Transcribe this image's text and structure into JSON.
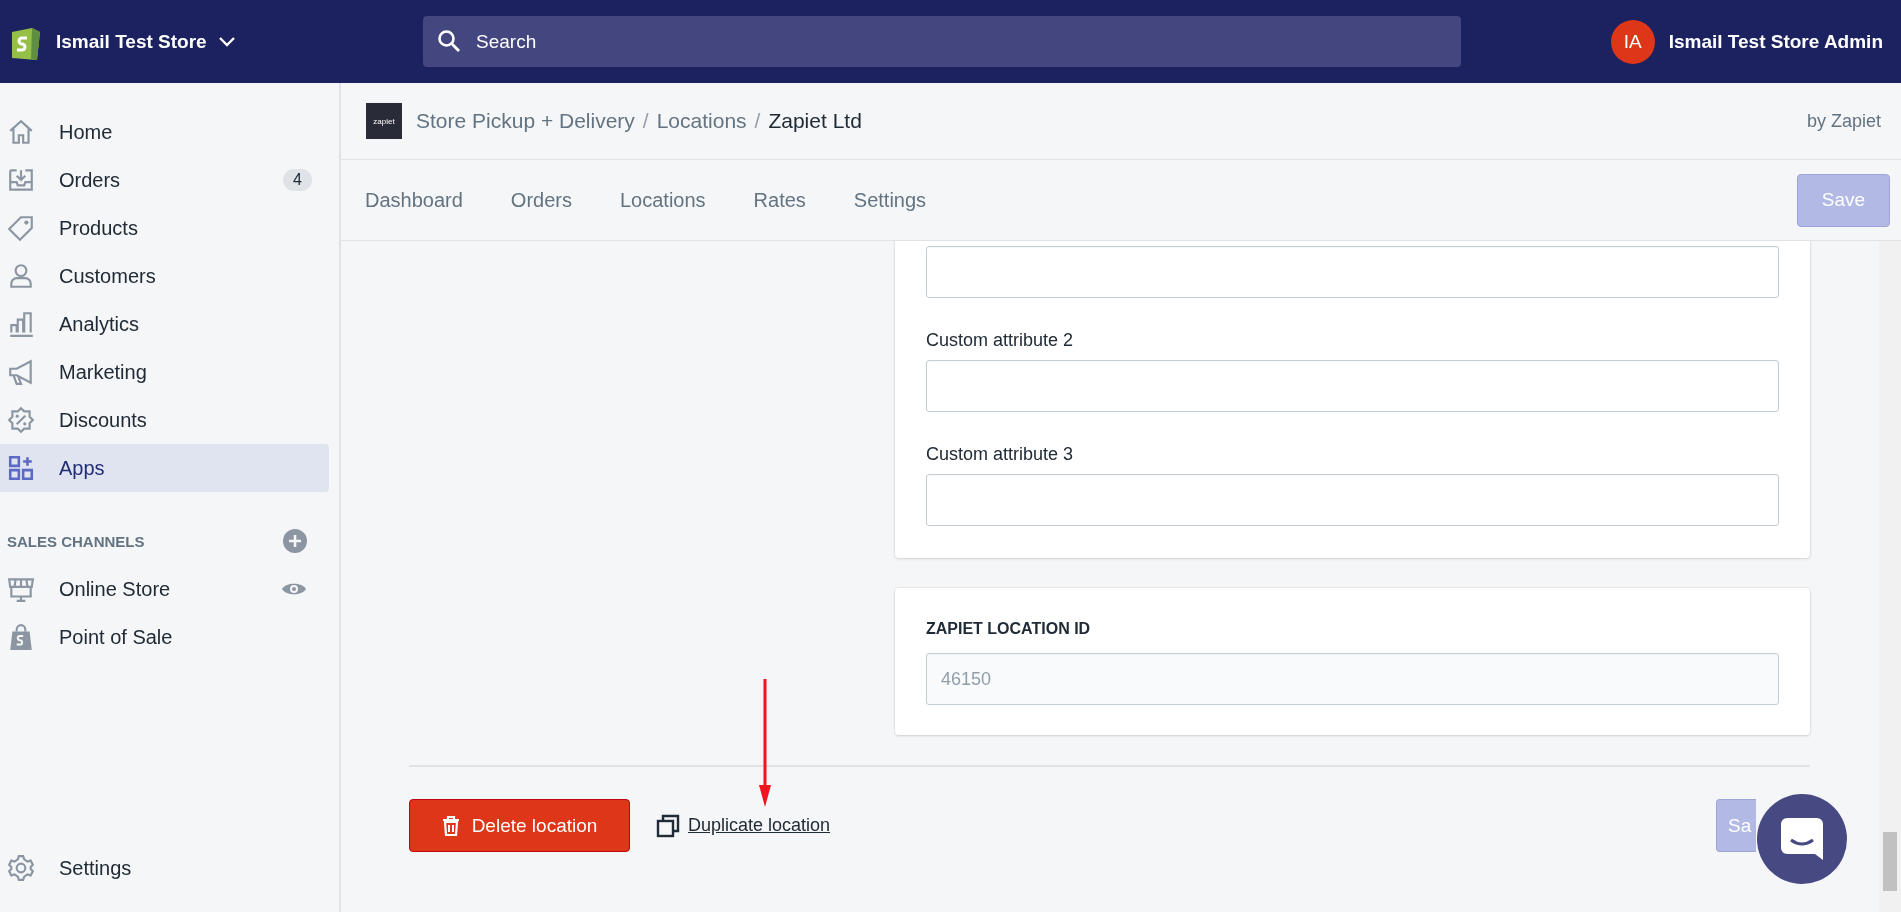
{
  "top_bar": {
    "store_name": "Ismail Test Store",
    "search": {
      "placeholder": "Search"
    },
    "user": {
      "initials": "IA",
      "name": "Ismail Test Store Admin"
    }
  },
  "sidebar": {
    "items": [
      {
        "label": "Home",
        "selected": false
      },
      {
        "label": "Orders",
        "selected": false,
        "badge": "4"
      },
      {
        "label": "Products",
        "selected": false
      },
      {
        "label": "Customers",
        "selected": false
      },
      {
        "label": "Analytics",
        "selected": false
      },
      {
        "label": "Marketing",
        "selected": false
      },
      {
        "label": "Discounts",
        "selected": false
      },
      {
        "label": "Apps",
        "selected": true
      }
    ],
    "sales_channels": {
      "title": "SALES CHANNELS",
      "items": [
        {
          "label": "Online Store",
          "selected": false
        },
        {
          "label": "Point of Sale",
          "selected": false
        }
      ]
    },
    "settings": {
      "label": "Settings",
      "selected": false
    }
  },
  "app_header": {
    "logo_text": "zapiet",
    "breadcrumb": [
      "Store Pickup + Delivery",
      "Locations",
      "Zapiet Ltd"
    ],
    "separator": "/",
    "by": "by Zapiet"
  },
  "tabs": [
    {
      "label": "Dashboard",
      "selected": false
    },
    {
      "label": "Orders",
      "selected": false
    },
    {
      "label": "Locations",
      "selected": false
    },
    {
      "label": "Rates",
      "selected": false
    },
    {
      "label": "Settings",
      "selected": false
    }
  ],
  "save_button": {
    "label": "Save",
    "disabled": true
  },
  "form": {
    "fields": [
      {
        "kind": "input"
      },
      {
        "kind": "input",
        "label": "Custom attribute 2"
      },
      {
        "kind": "input",
        "label": "Custom attribute 3"
      }
    ]
  },
  "location_id": {
    "title": "ZAPIET LOCATION ID",
    "value": "46150",
    "disabled": true
  },
  "actions": {
    "delete": "Delete location",
    "duplicate": "Duplicate location",
    "save": {
      "label": "Sa",
      "disabled": true
    }
  }
}
